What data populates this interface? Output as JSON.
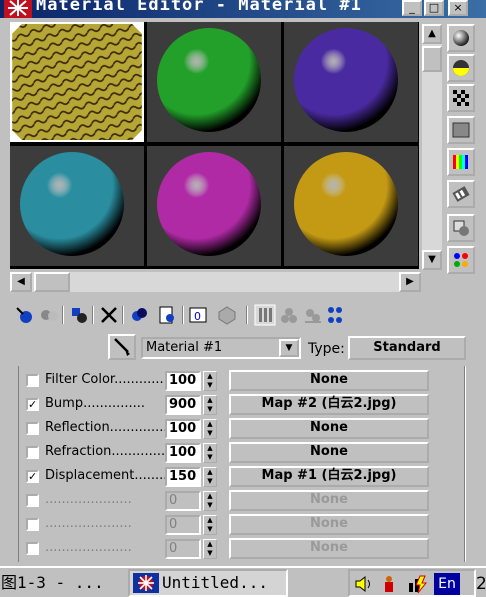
{
  "window": {
    "title": "Material Editor - Material #1",
    "buttons": {
      "minimize": "_",
      "maximize": "□",
      "close": "×"
    }
  },
  "sample_slots": [
    {
      "name": "Material #1",
      "color": "#b5a636",
      "texture": "rock",
      "selected": true
    },
    {
      "name": "slot-2",
      "color": "#22a02a"
    },
    {
      "name": "slot-3",
      "color": "#4a2aa0"
    },
    {
      "name": "slot-4",
      "color": "#2a8ea0"
    },
    {
      "name": "slot-5",
      "color": "#b02aa6"
    },
    {
      "name": "slot-6",
      "color": "#c49a14"
    }
  ],
  "side_toolbar": [
    "sample-type-sphere-icon",
    "backlight-icon",
    "background-checker-icon",
    "sample-uv-tiling-icon",
    "video-color-check-icon",
    "make-preview-icon",
    "options-icon",
    "select-by-material-icon"
  ],
  "bottom_toolbar": [
    "get-material-icon",
    "put-to-scene-icon",
    "assign-material-icon",
    "reset-map-icon",
    "copy-material-icon",
    "put-to-library-icon",
    "material-effects-channel-icon",
    "show-map-in-viewport-icon",
    "show-end-result-icon",
    "go-to-parent-icon",
    "go-forward-icon",
    "select-by-material-icon"
  ],
  "material": {
    "name": "Material #1",
    "type_label": "Type:",
    "type_value": "Standard"
  },
  "maps": [
    {
      "label": "Filter Color",
      "checked": false,
      "amount": "100",
      "map": "None",
      "enabled": true
    },
    {
      "label": "Bump",
      "checked": true,
      "amount": "900",
      "map": "Map #2 (白云2.jpg)",
      "enabled": true
    },
    {
      "label": "Reflection",
      "checked": false,
      "amount": "100",
      "map": "None",
      "enabled": true
    },
    {
      "label": "Refraction",
      "checked": false,
      "amount": "100",
      "map": "None",
      "enabled": true
    },
    {
      "label": "Displacement",
      "checked": true,
      "amount": "150",
      "map": "Map #1 (白云2.jpg)",
      "enabled": true
    },
    {
      "label": "",
      "checked": false,
      "amount": "0",
      "map": "None",
      "enabled": false
    },
    {
      "label": "",
      "checked": false,
      "amount": "0",
      "map": "None",
      "enabled": false
    },
    {
      "label": "",
      "checked": false,
      "amount": "0",
      "map": "None",
      "enabled": false
    }
  ],
  "taskbar": {
    "item1": "图1-3 - ...",
    "item2": "Untitled...",
    "language": "En",
    "clock": "2"
  }
}
